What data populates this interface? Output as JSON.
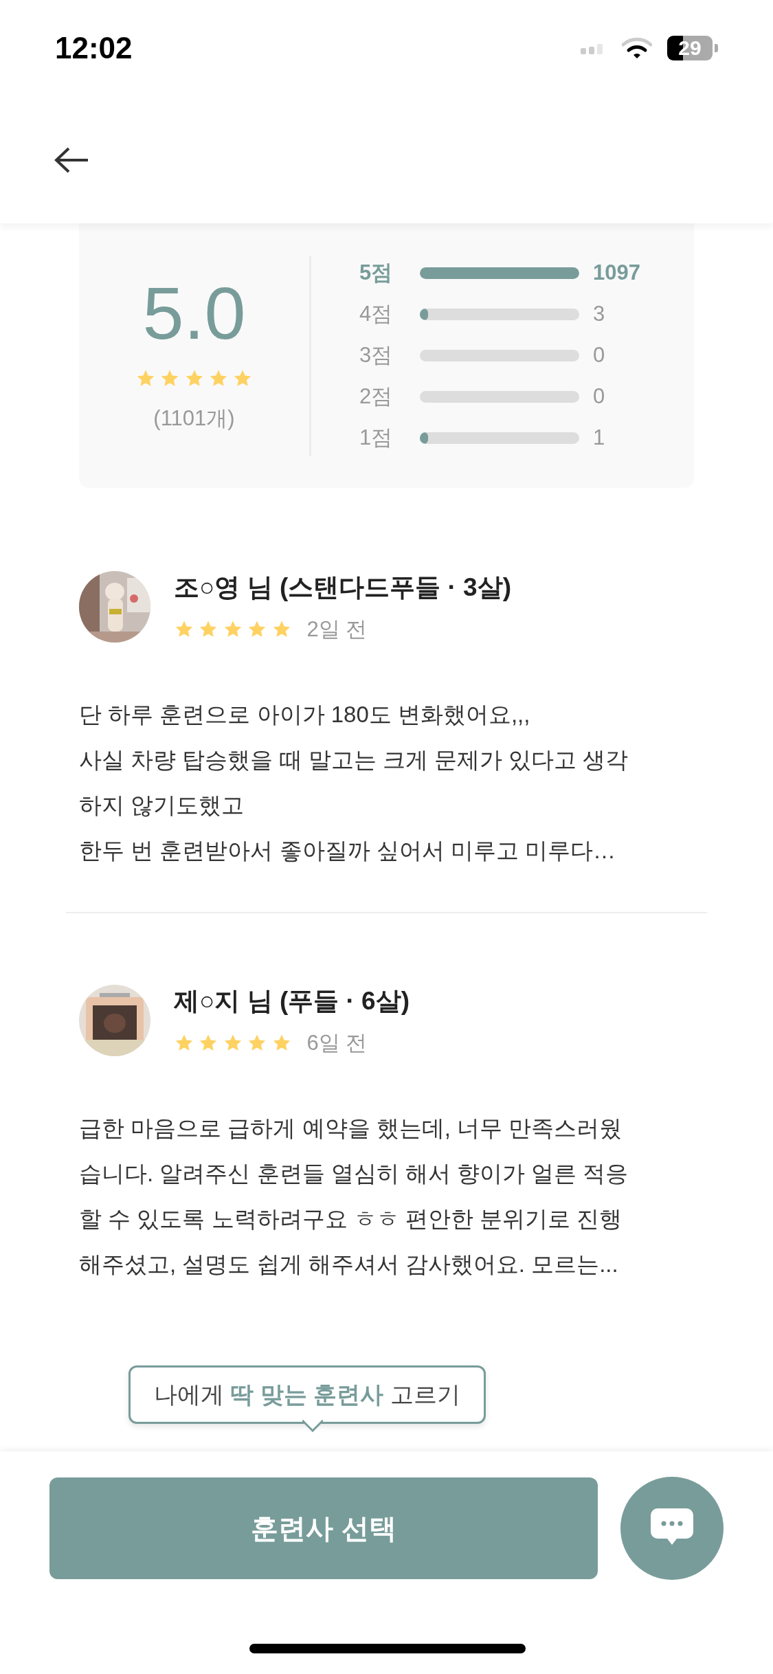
{
  "status_bar": {
    "time": "12:02",
    "battery": "29"
  },
  "rating_summary": {
    "score": "5.0",
    "stars": 5,
    "count": "(1101개)",
    "rows": [
      {
        "label": "5점",
        "level": 1.0,
        "count": "1097",
        "highlighted": true
      },
      {
        "label": "4점",
        "level": 0.05,
        "count": "3",
        "highlighted": false
      },
      {
        "label": "3점",
        "level": 0,
        "count": "0",
        "highlighted": false
      },
      {
        "label": "2점",
        "level": 0,
        "count": "0",
        "highlighted": false
      },
      {
        "label": "1점",
        "level": 0.05,
        "count": "1",
        "highlighted": false
      }
    ]
  },
  "reviews": [
    {
      "author": "조○영 님 (스탠다드푸들 · 3살)",
      "stars": 5,
      "time": "2일 전",
      "body": "단 하루 훈련으로 아이가 180도 변화했어요,,,\n사실 차량 탑승했을 때 말고는 크게 문제가 있다고 생각\n하지 않기도했고\n한두 번 훈련받아서 좋아질까 싶어서 미루고 미루다…"
    },
    {
      "author": "제○지 님 (푸들 · 6살)",
      "stars": 5,
      "time": "6일 전",
      "body": "급한 마음으로 급하게 예약을 했는데, 너무 만족스러웠\n습니다. 알려주신 훈련들 열심히 해서 향이가 얼른 적응\n할 수 있도록 노력하려구요 ㅎㅎ 편안한 분위기로 진행\n해주셨고, 설명도 쉽게 해주셔서 감사했어요. 모르는..."
    }
  ],
  "tooltip": "나에게 **딱 맞는 훈련사** 고르기",
  "primary_button": "훈련사 선택"
}
